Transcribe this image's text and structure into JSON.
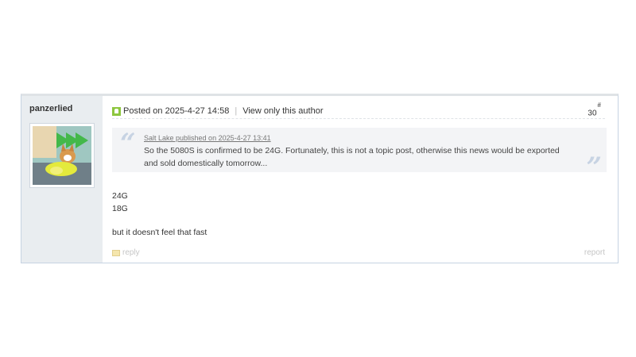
{
  "post": {
    "author": "panzerlied",
    "posted_label": "Posted on 2025-4-27 14:58",
    "separator": "|",
    "view_only_label": "View only this author",
    "floor_number": "30",
    "floor_mark": "#",
    "quote": {
      "source": "Salt Lake published on 2025-4-27 13:41",
      "text": "So the 5080S is confirmed to be 24G. Fortunately, this is not a topic post, otherwise this news would be exported and sold domestically tomorrow...",
      "open_mark": "“",
      "close_mark": "”"
    },
    "lines": [
      "24G",
      "18G",
      "but it doesn't feel that fast"
    ],
    "reply_label": "reply",
    "report_label": "report"
  },
  "colors": {
    "sidebar_bg": "#e9edf0",
    "online_icon": "#8dc63f",
    "quote_bg": "#f3f4f6",
    "quote_mark": "#c7d3e3"
  },
  "icons": {
    "online": "online-status-icon",
    "reply": "reply-icon"
  }
}
